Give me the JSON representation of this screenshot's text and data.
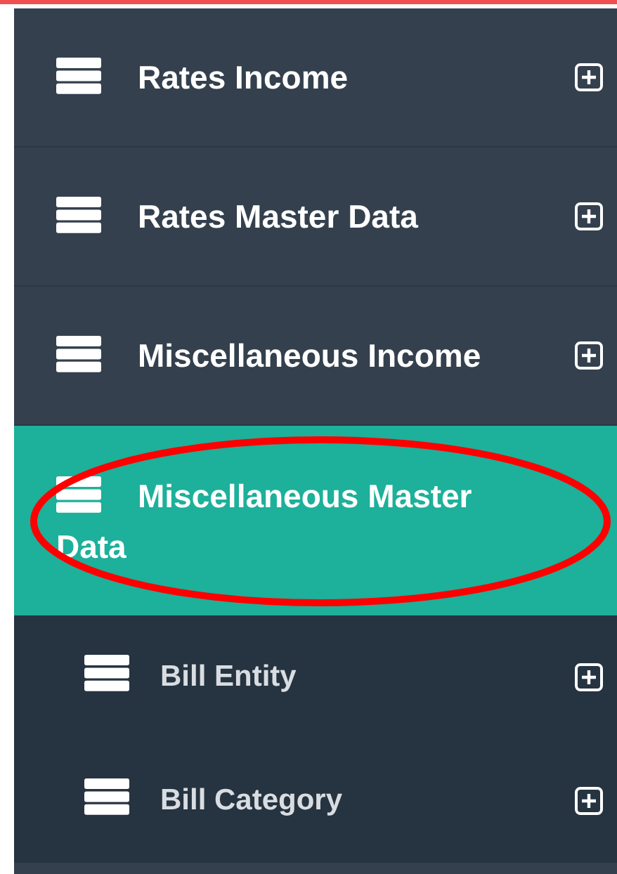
{
  "menu": {
    "items": [
      {
        "label": "Rates Income",
        "selected": false,
        "expanded": false
      },
      {
        "label": "Rates Master Data",
        "selected": false,
        "expanded": false
      },
      {
        "label": "Miscellaneous Income",
        "selected": false,
        "expanded": false
      },
      {
        "label": "Miscellaneous Master Data",
        "selected": true,
        "expanded": true,
        "children": [
          {
            "label": "Bill Entity",
            "selected": false,
            "expanded": false
          },
          {
            "label": "Bill Category",
            "selected": false,
            "expanded": false
          }
        ]
      }
    ]
  },
  "annotation": {
    "kind": "ellipse"
  }
}
